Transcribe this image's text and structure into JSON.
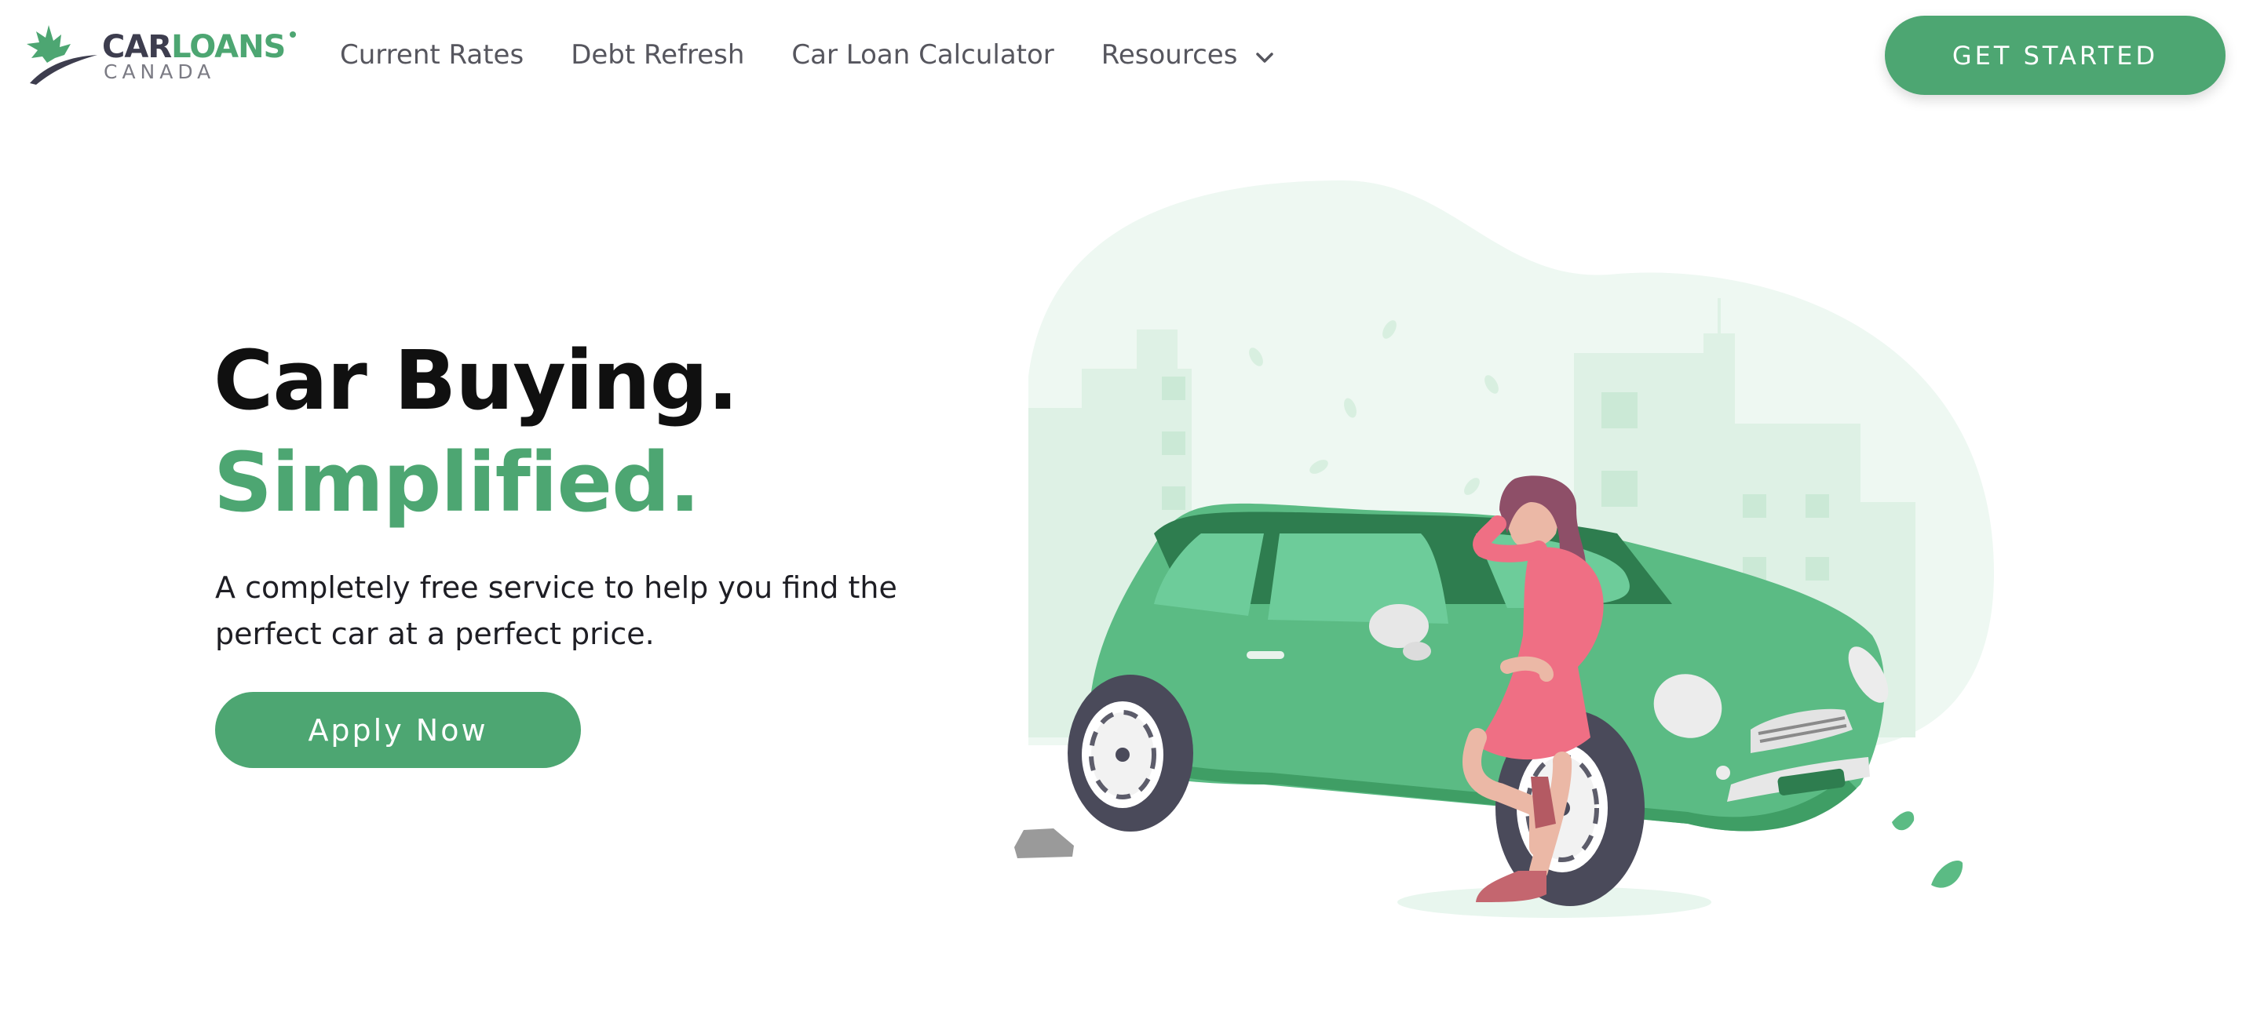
{
  "brand": {
    "word_car": "CAR",
    "word_loans": "LOANS",
    "sub": "CANADA",
    "logo_icon": "maple-leaf-swoosh-icon",
    "colors": {
      "green": "#4da672",
      "dark": "#3d3d4e",
      "gray": "#7b7b84"
    }
  },
  "nav": {
    "items": [
      {
        "label": "Current Rates"
      },
      {
        "label": "Debt Refresh"
      },
      {
        "label": "Car Loan Calculator"
      },
      {
        "label": "Resources",
        "icon": "chevron-down-icon"
      }
    ],
    "cta_label": "GET STARTED"
  },
  "hero": {
    "title_line1": "Car Buying.",
    "title_line2": "Simplified.",
    "description": "A completely free service to help you find the perfect car at a perfect price.",
    "cta_label": "Apply Now",
    "illustration": "woman-leaning-on-green-car-illustration"
  }
}
